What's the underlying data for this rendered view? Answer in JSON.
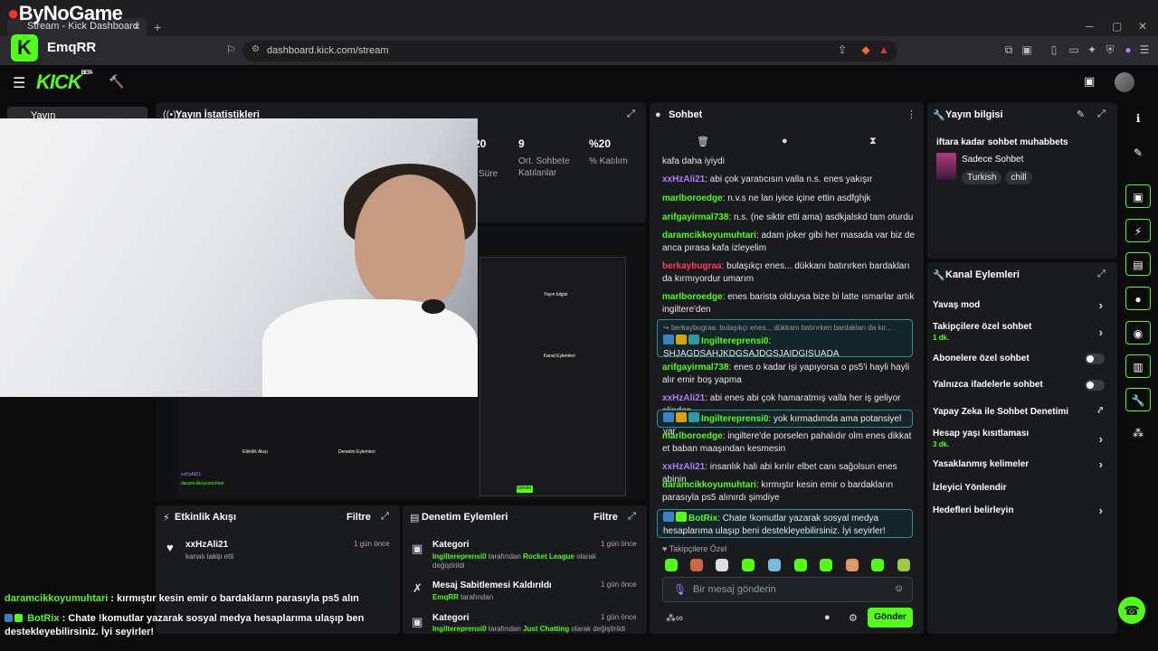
{
  "overlay": {
    "brand": "ByNoGame",
    "user": "EmqRR",
    "chat": [
      {
        "user": "daramcikkoyumuhtari",
        "sep": " : ",
        "text": "kırmıştır kesin emir o bardakların parasıyla ps5 alın"
      },
      {
        "user": "BotRix",
        "sep": " : ",
        "text": "Chate !komutlar yazarak sosyal medya hesaplarıma ulaşıp ben",
        "text2": "destekleyebilirsiniz. İyi seyirler!"
      }
    ]
  },
  "browser": {
    "tab_title": "Stream - Kick Dashboard",
    "url": "dashboard.kick.com/stream"
  },
  "header": {
    "logo": "KICK",
    "beta": "BETA"
  },
  "sidebar": {
    "item": "Yayın"
  },
  "stats": {
    "title": "Yayın İstatistikleri",
    "items": [
      {
        "value": "20",
        "label": "Süre"
      },
      {
        "value": "9",
        "label": "Ort. Sohbete Katılanlar"
      },
      {
        "value": "%20",
        "label": "% Katılım"
      }
    ]
  },
  "activity": {
    "title": "Etkinlik Akışı",
    "filter": "Filtre",
    "events": [
      {
        "user": "xxHzAli21",
        "desc": "kanalı takip etti",
        "time": "1 gün önce"
      }
    ]
  },
  "moderation": {
    "title": "Denetim Eylemleri",
    "filter": "Filtre",
    "actions": [
      {
        "title": "Kategori",
        "by": "Ingiltereprensi0",
        "mid": " tarafından ",
        "target": "Rocket League",
        "tail": " olarak",
        "tail2": "değiştirildi",
        "time": "1 gün önce"
      },
      {
        "title": "Mesaj Sabitlemesi Kaldırıldı",
        "by": "EmqRR",
        "mid": " tarafından",
        "target": "",
        "tail": "",
        "tail2": "",
        "time": "1 gün önce"
      },
      {
        "title": "Kategori",
        "by": "Ingiltereprensi0",
        "mid": " tarafından ",
        "target": "Just Chatting",
        "tail": " olarak değiştirildi",
        "tail2": "",
        "time": "1 gün önce"
      }
    ]
  },
  "chat": {
    "title": "Sohbet",
    "input_placeholder": "Bir mesaj gönderin",
    "send": "Gönder",
    "subs_label": "Takipçilere Özel",
    "messages": [
      {
        "user": "",
        "color": "#e8e8e8",
        "text": "kafa daha iyiydi"
      },
      {
        "user": "xxHzAli21",
        "color": "#b57cff",
        "text": ": abi çok yaratıcısın valla n.s. enes yakışır"
      },
      {
        "user": "marlboroedge",
        "color": "#53fc18",
        "text": ": n.v.s ne lan iyice içine ettin asdfghjk"
      },
      {
        "user": "arifgayirmal738",
        "color": "#53fc18",
        "text": ": n.s. (ne siktir etti ama) asdkjalskd tam oturdu"
      },
      {
        "user": "daramcikkoyumuhtari",
        "color": "#53fc18",
        "text": ": adam joker gibi her masada var biz de anca pırasa kafa izleyelim"
      },
      {
        "user": "berkaybugraa",
        "color": "#ff3b5c",
        "text": ": bulaşıkçı enes... dükkanı batırırken bardakları da kırmıyordur umarım"
      },
      {
        "user": "marlboroedge",
        "color": "#53fc18",
        "text": ": enes barista olduysa bize bi latte ısmarlar artık ingiltere'den"
      }
    ],
    "reply": {
      "quote": "berkaybugraa: bulaşıkçı enes... dükkanı batırırken bardakları da kır...",
      "user": "Ingiltereprensi0",
      "text": "SHJAGDSAHJKDGSAJDGSJAIDGISUADA"
    },
    "messages2": [
      {
        "user": "arifgayirmal738",
        "color": "#53fc18",
        "text": ": enes o kadar işi yapıyorsa o ps5'i hayli hayli alır emir boş yapma"
      },
      {
        "user": "xxHzAli21",
        "color": "#b57cff",
        "text": ": abi enes abi çok hamaratmış valla her iş geliyor elinden"
      }
    ],
    "hl2": {
      "user": "Ingiltereprensi0",
      "text": ": yok kırmadımda ama potansiyel var"
    },
    "messages3": [
      {
        "user": "marlboroedge",
        "color": "#53fc18",
        "text": ": ingiltere'de porselen pahalıdır olm enes dikkat et baban maaşından kesmesin"
      },
      {
        "user": "xxHzAli21",
        "color": "#b57cff",
        "text": ": insanlık hali abi kırılır elbet canı sağolsun enes abinin"
      },
      {
        "user": "daramcikkoyumuhtari",
        "color": "#53fc18",
        "text": ": kırmıştır kesin emir o bardakların parasıyla ps5 alınırdı şimdiye"
      }
    ],
    "bot": {
      "user": "BotRix",
      "text": ": Chate !komutlar yazarak sosyal medya hesaplarıma ulaşıp beni destekleyebilirsiniz. İyi seyirler!"
    }
  },
  "stream_info": {
    "title": "Yayın bilgisi",
    "stream_title": "iftara kadar sohbet muhabbets",
    "category": "Sadece Sohbet",
    "tags": [
      "Turkish",
      "chill"
    ]
  },
  "channel_actions": {
    "title": "Kanal Eylemleri",
    "items": [
      {
        "label": "Yavaş mod",
        "sub": "",
        "ctrl": "chev"
      },
      {
        "label": "Takipçilere özel sohbet",
        "sub": "1 dk.",
        "ctrl": "chev"
      },
      {
        "label": "Abonelere özel sohbet",
        "sub": "",
        "ctrl": "toggle"
      },
      {
        "label": "Yalnızca ifadelerle sohbet",
        "sub": "",
        "ctrl": "toggle"
      },
      {
        "label": "Yapay Zeka ile Sohbet Denetimi",
        "sub": "",
        "ctrl": "ext"
      },
      {
        "label": "Hesap yaşı kısıtlaması",
        "sub": "3 dk.",
        "ctrl": "chev"
      },
      {
        "label": "Yasaklanmış kelimeler",
        "sub": "",
        "ctrl": "chev"
      },
      {
        "label": "İzleyici Yönlendir",
        "sub": "",
        "ctrl": ""
      },
      {
        "label": "Hedefleri belirleyin",
        "sub": "",
        "ctrl": "chev"
      }
    ]
  },
  "colors": {
    "accent": "#53fc18",
    "panel": "#191b1f",
    "bg": "#0b0b0c",
    "purple": "#b57cff",
    "red": "#ff3b5c"
  }
}
